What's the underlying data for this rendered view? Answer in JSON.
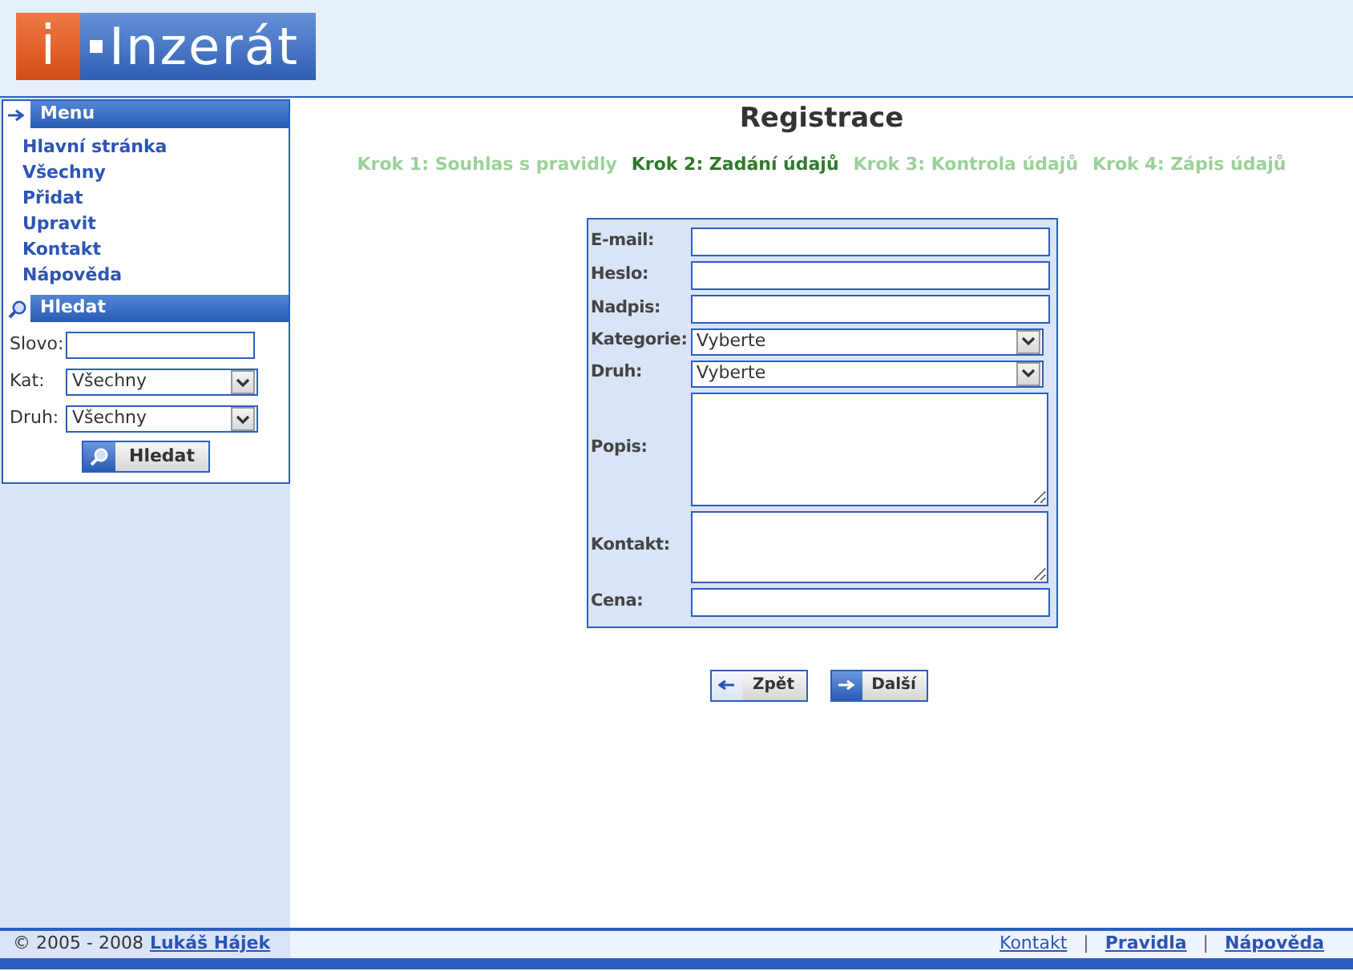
{
  "logo": {
    "mark": "i",
    "text": "Inzerát"
  },
  "menu": {
    "title": "Menu",
    "items": [
      {
        "label": "Hlavní stránka"
      },
      {
        "label": "Všechny"
      },
      {
        "label": "Přidat"
      },
      {
        "label": "Upravit"
      },
      {
        "label": "Kontakt"
      },
      {
        "label": "Nápověda"
      }
    ]
  },
  "search": {
    "title": "Hledat",
    "fields": [
      {
        "kind": "text",
        "label": "Slovo:"
      },
      {
        "kind": "select",
        "label": "Kat:",
        "value": "Všechny"
      },
      {
        "kind": "select",
        "label": "Druh:",
        "value": "Všechny"
      }
    ],
    "button": "Hledat"
  },
  "page_title": "Registrace",
  "steps": [
    {
      "label": "Krok 1: Souhlas s pravidly",
      "selected": false
    },
    {
      "label": "Krok 2: Zadání údajů",
      "selected": true
    },
    {
      "label": "Krok 3: Kontrola údajů",
      "selected": false
    },
    {
      "label": "Krok 4: Zápis údajů",
      "selected": false
    }
  ],
  "form": [
    {
      "kind": "text",
      "label": "E-mail:"
    },
    {
      "kind": "text",
      "label": "Heslo:"
    },
    {
      "kind": "text",
      "label": "Nadpis:"
    },
    {
      "kind": "select",
      "label": "Kategorie:",
      "value": "Vyberte"
    },
    {
      "kind": "select",
      "label": "Druh:",
      "value": "Vyberte"
    },
    {
      "kind": "textarea",
      "label": "Popis:"
    },
    {
      "kind": "textarea",
      "label": "Kontakt:"
    },
    {
      "kind": "text",
      "label": "Cena:"
    }
  ],
  "buttons": [
    {
      "label": "Zpět",
      "kind": "back"
    },
    {
      "label": "Další",
      "kind": "next"
    }
  ],
  "footer": {
    "copyright": "© 2005 - 2008",
    "author": "Lukáš Hájek",
    "links": [
      {
        "label": "Kontakt",
        "bold": false
      },
      {
        "label": "Pravidla",
        "bold": true
      },
      {
        "label": "Nápověda",
        "bold": true
      }
    ],
    "separators": [
      "|",
      "|"
    ]
  }
}
